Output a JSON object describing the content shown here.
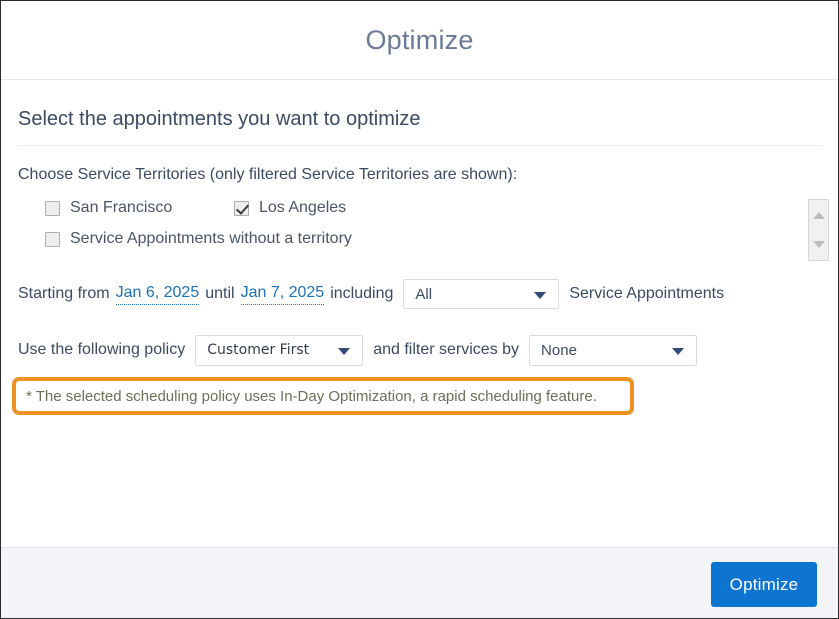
{
  "header": {
    "title": "Optimize"
  },
  "body": {
    "section_heading": "Select the appointments you want to optimize",
    "territories_label": "Choose Service Territories (only filtered Service Territories are shown):",
    "territories": [
      {
        "label": "San Francisco",
        "checked": false
      },
      {
        "label": "Los Angeles",
        "checked": true
      },
      {
        "label": "Service Appointments without a territory",
        "checked": false
      }
    ],
    "date_row": {
      "prefix": "Starting from",
      "start_date": "Jan 6, 2025",
      "middle": "until",
      "end_date": "Jan 7, 2025",
      "including": "including",
      "count_select_value": "All",
      "suffix": "Service Appointments"
    },
    "policy_row": {
      "prefix": "Use the following policy",
      "policy_select_value": "Customer First",
      "middle": "and filter services by",
      "filter_select_value": "None"
    },
    "warning": {
      "text": "* The selected scheduling policy uses In-Day Optimization, a rapid scheduling feature.",
      "border_color": "#ef9123"
    }
  },
  "footer": {
    "primary_button_label": "Optimize",
    "primary_button_color": "#0d74d1"
  }
}
